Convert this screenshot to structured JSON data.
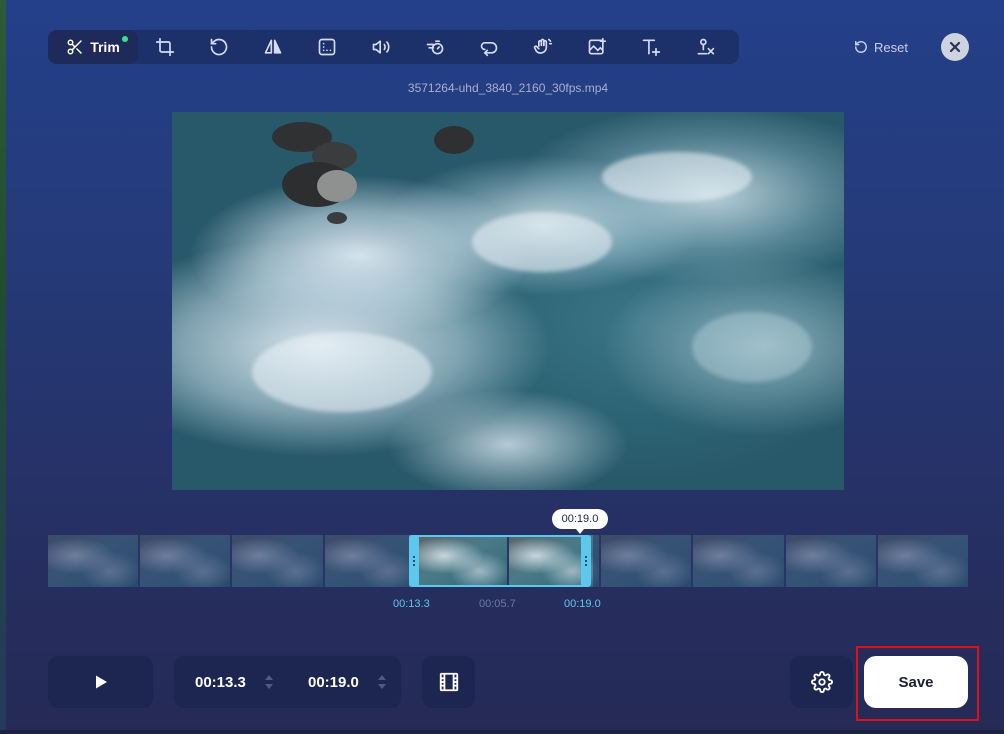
{
  "toolbar": {
    "active_tool": "Trim",
    "tools": [
      "crop",
      "rotate",
      "flip",
      "resize",
      "volume",
      "speed",
      "loop",
      "stabilize",
      "image",
      "text",
      "remove-watermark"
    ]
  },
  "header": {
    "reset_label": "Reset",
    "filename": "3571264-uhd_3840_2160_30fps.mp4"
  },
  "timeline": {
    "playhead_time": "00:19.0",
    "start_label": "00:13.3",
    "duration_label": "00:05.7",
    "end_label": "00:19.0",
    "frame_count": 10
  },
  "controls": {
    "start_time": "00:13.3",
    "end_time": "00:19.0",
    "save_label": "Save"
  },
  "colors": {
    "accent": "#5cc8ee",
    "highlight": "#e0101a",
    "active_dot": "#3ee08a"
  },
  "icons": [
    "scissors-icon",
    "crop-icon",
    "rotate-icon",
    "flip-icon",
    "resize-icon",
    "volume-icon",
    "speed-icon",
    "loop-icon",
    "stabilize-icon",
    "image-icon",
    "text-icon",
    "remove-icon",
    "reset-icon",
    "close-icon",
    "play-icon",
    "filmstrip-icon",
    "gear-icon"
  ]
}
